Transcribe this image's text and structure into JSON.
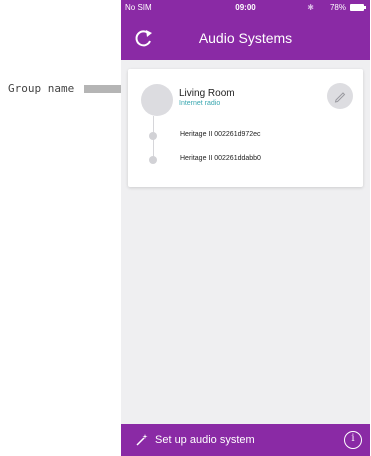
{
  "annotation": {
    "label": "Group name"
  },
  "status_bar": {
    "carrier": "No SIM",
    "time": "09:00",
    "battery": "78%"
  },
  "nav": {
    "title": "Audio Systems",
    "refresh_icon": "refresh-icon"
  },
  "group": {
    "name": "Living Room",
    "source": "Internet radio",
    "edit_icon": "pencil-icon",
    "devices": [
      {
        "name": "Heritage II 002261d972ec"
      },
      {
        "name": "Heritage II 002261ddabb0"
      }
    ]
  },
  "bottom_bar": {
    "setup_label": "Set up audio system",
    "setup_icon": "magic-wand-icon",
    "info_label": "i",
    "info_icon": "info-icon"
  },
  "colors": {
    "brand_purple": "#8a2aa5",
    "source_teal": "#3aa7b0",
    "background": "#efeff1"
  }
}
